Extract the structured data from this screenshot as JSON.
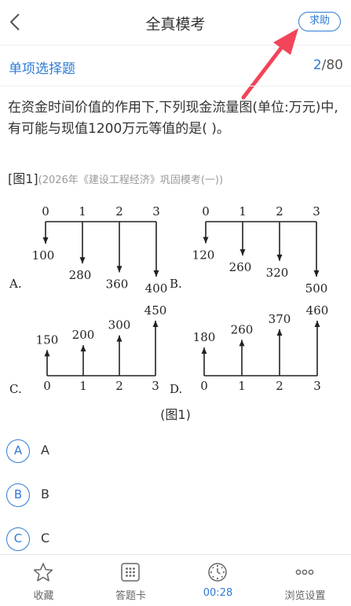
{
  "header": {
    "back_icon": "chevron-left-icon",
    "title": "全真模考",
    "help_label": "求助"
  },
  "section": {
    "title": "单项选择题",
    "current": "2",
    "total": "/80"
  },
  "question": {
    "text": "在资金时间价值的作用下,下列现金流量图(单位:万元)中,有可能与现值1200万元等值的是( )。",
    "ref_label": "[图1]",
    "source": "(2026年《建设工程经济》巩固模考(一))"
  },
  "figure": {
    "caption": "(图1)",
    "panels": [
      {
        "label": "A.",
        "direction": "down",
        "periods": [
          "0",
          "1",
          "2",
          "3"
        ],
        "values": [
          "100",
          "280",
          "360",
          "400"
        ],
        "amounts": [
          100,
          280,
          360,
          400
        ]
      },
      {
        "label": "B.",
        "direction": "down",
        "periods": [
          "0",
          "1",
          "2",
          "3"
        ],
        "values": [
          "120",
          "260",
          "320",
          "500"
        ],
        "amounts": [
          120,
          260,
          320,
          500
        ]
      },
      {
        "label": "C.",
        "direction": "up",
        "periods": [
          "0",
          "1",
          "2",
          "3"
        ],
        "values": [
          "150",
          "200",
          "300",
          "450"
        ],
        "amounts": [
          150,
          200,
          300,
          450
        ]
      },
      {
        "label": "D.",
        "direction": "up",
        "periods": [
          "0",
          "1",
          "2",
          "3"
        ],
        "values": [
          "180",
          "260",
          "370",
          "460"
        ],
        "amounts": [
          180,
          260,
          370,
          460
        ]
      }
    ]
  },
  "options": [
    {
      "letter": "A",
      "text": "A"
    },
    {
      "letter": "B",
      "text": "B"
    },
    {
      "letter": "C",
      "text": "C"
    }
  ],
  "tabbar": {
    "favorite": "收藏",
    "answer_card": "答题卡",
    "timer": "00:28",
    "view_settings": "浏览设置"
  },
  "colors": {
    "accent": "#2f7bd6",
    "arrow_annotation": "#f2455a"
  }
}
